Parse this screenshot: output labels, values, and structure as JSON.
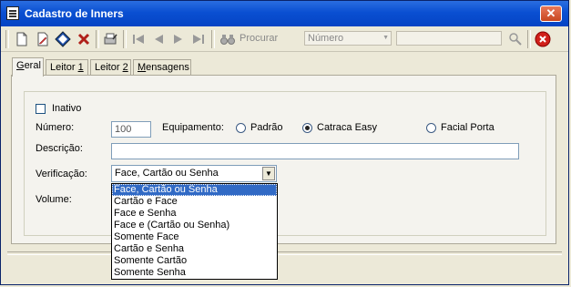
{
  "window": {
    "title": "Cadastro de Inners"
  },
  "toolbar": {
    "procurar_label": "Procurar",
    "search_field": "Número",
    "search_value": ""
  },
  "tabs": [
    {
      "prefix": "",
      "mnemonic": "G",
      "rest": "eral"
    },
    {
      "prefix": "Leitor ",
      "mnemonic": "1",
      "rest": ""
    },
    {
      "prefix": "Leitor ",
      "mnemonic": "2",
      "rest": ""
    },
    {
      "prefix": "",
      "mnemonic": "M",
      "rest": "ensagens"
    }
  ],
  "form": {
    "inativo_label": "Inativo",
    "numero_label": "Número:",
    "numero_value": "100",
    "equipamento_label": "Equipamento:",
    "equipamento_options": [
      "Padrão",
      "Catraca Easy",
      "Facial Porta"
    ],
    "equipamento_selected": "Catraca Easy",
    "descricao_label": "Descrição:",
    "descricao_value": "",
    "verificacao_label": "Verificação:",
    "verificacao_value": "Face, Cartão ou Senha",
    "volume_label": "Volume:"
  },
  "verificacao_options": [
    "Face, Cartão ou Senha",
    "Cartão e Face",
    "Face e Senha",
    "Face e (Cartão ou Senha)",
    "Somente Face",
    "Cartão e Senha",
    "Somente Cartão",
    "Somente Senha"
  ],
  "colors": {
    "title_bar": "#0a4fd2",
    "selection": "#316ac5",
    "window_bg": "#ece9d8"
  }
}
